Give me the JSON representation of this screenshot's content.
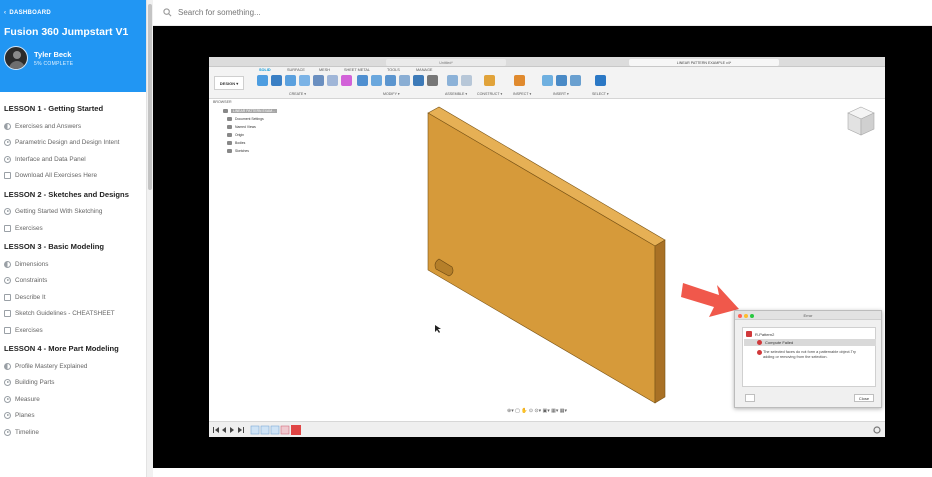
{
  "sidebar": {
    "back_label": "DASHBOARD",
    "course_title": "Fusion 360 Jumpstart V1",
    "user_name": "Tyler Beck",
    "progress_text": "5% COMPLETE",
    "lessons": [
      {
        "title": "LESSON 1 - Getting Started",
        "items": [
          {
            "label": "Exercises and Answers",
            "icon": "half-circle-icon"
          },
          {
            "label": "Parametric Design and Design Intent",
            "icon": "play-icon"
          },
          {
            "label": "Interface and Data Panel",
            "icon": "play-icon"
          },
          {
            "label": "Download All Exercises Here",
            "icon": "document-icon"
          }
        ]
      },
      {
        "title": "LESSON 2 - Sketches and Designs",
        "items": [
          {
            "label": "Getting Started With Sketching",
            "icon": "play-icon"
          },
          {
            "label": "Exercises",
            "icon": "document-icon"
          }
        ]
      },
      {
        "title": "LESSON 3 - Basic Modeling",
        "items": [
          {
            "label": "Dimensions",
            "icon": "half-circle-icon"
          },
          {
            "label": "Constraints",
            "icon": "play-icon"
          },
          {
            "label": "Describe It",
            "icon": "document-icon"
          },
          {
            "label": "Sketch Guidelines - CHEATSHEET",
            "icon": "document-icon"
          },
          {
            "label": "Exercises",
            "icon": "document-icon"
          }
        ]
      },
      {
        "title": "LESSON 4 - More Part Modeling",
        "items": [
          {
            "label": "Profile Mastery Explained",
            "icon": "half-circle-icon"
          },
          {
            "label": "Building Parts",
            "icon": "play-icon"
          },
          {
            "label": "Measure",
            "icon": "play-icon"
          },
          {
            "label": "Planes",
            "icon": "play-icon"
          },
          {
            "label": "Timeline",
            "icon": "play-icon"
          }
        ]
      }
    ]
  },
  "search": {
    "placeholder": "Search for something..."
  },
  "fusion": {
    "tab_inactive": "Untitled*",
    "tab_active": "LINEAR PATTERN EXAMPLE v4*",
    "design_button": "DESIGN ▾",
    "toolbar_tabs": [
      "SOLID",
      "SURFACE",
      "MESH",
      "SHEET METAL",
      "TOOLS",
      "MANAGE"
    ],
    "groups": [
      "CREATE ▾",
      "MODIFY ▾",
      "ASSEMBLE ▾",
      "CONSTRUCT ▾",
      "INSPECT ▾",
      "INSERT ▾",
      "SELECT ▾"
    ],
    "browser_label": "BROWSER",
    "tree": [
      "LINEAR PATTERN EXAM...",
      "Document Settings",
      "Named Views",
      "Origin",
      "Bodies",
      "Sketches"
    ]
  },
  "dialog": {
    "title": "Error",
    "feature": "R-Pattern2",
    "status": "Compute Failed",
    "message": "The selected faces do not form a patternable object.Try adding or removing from the selection.",
    "close_label": "Close"
  },
  "colors": {
    "sidebar_header": "#2196f3",
    "plate_face": "#d69a3a",
    "error_red": "#d0393b",
    "arrow": "#f0584b"
  }
}
